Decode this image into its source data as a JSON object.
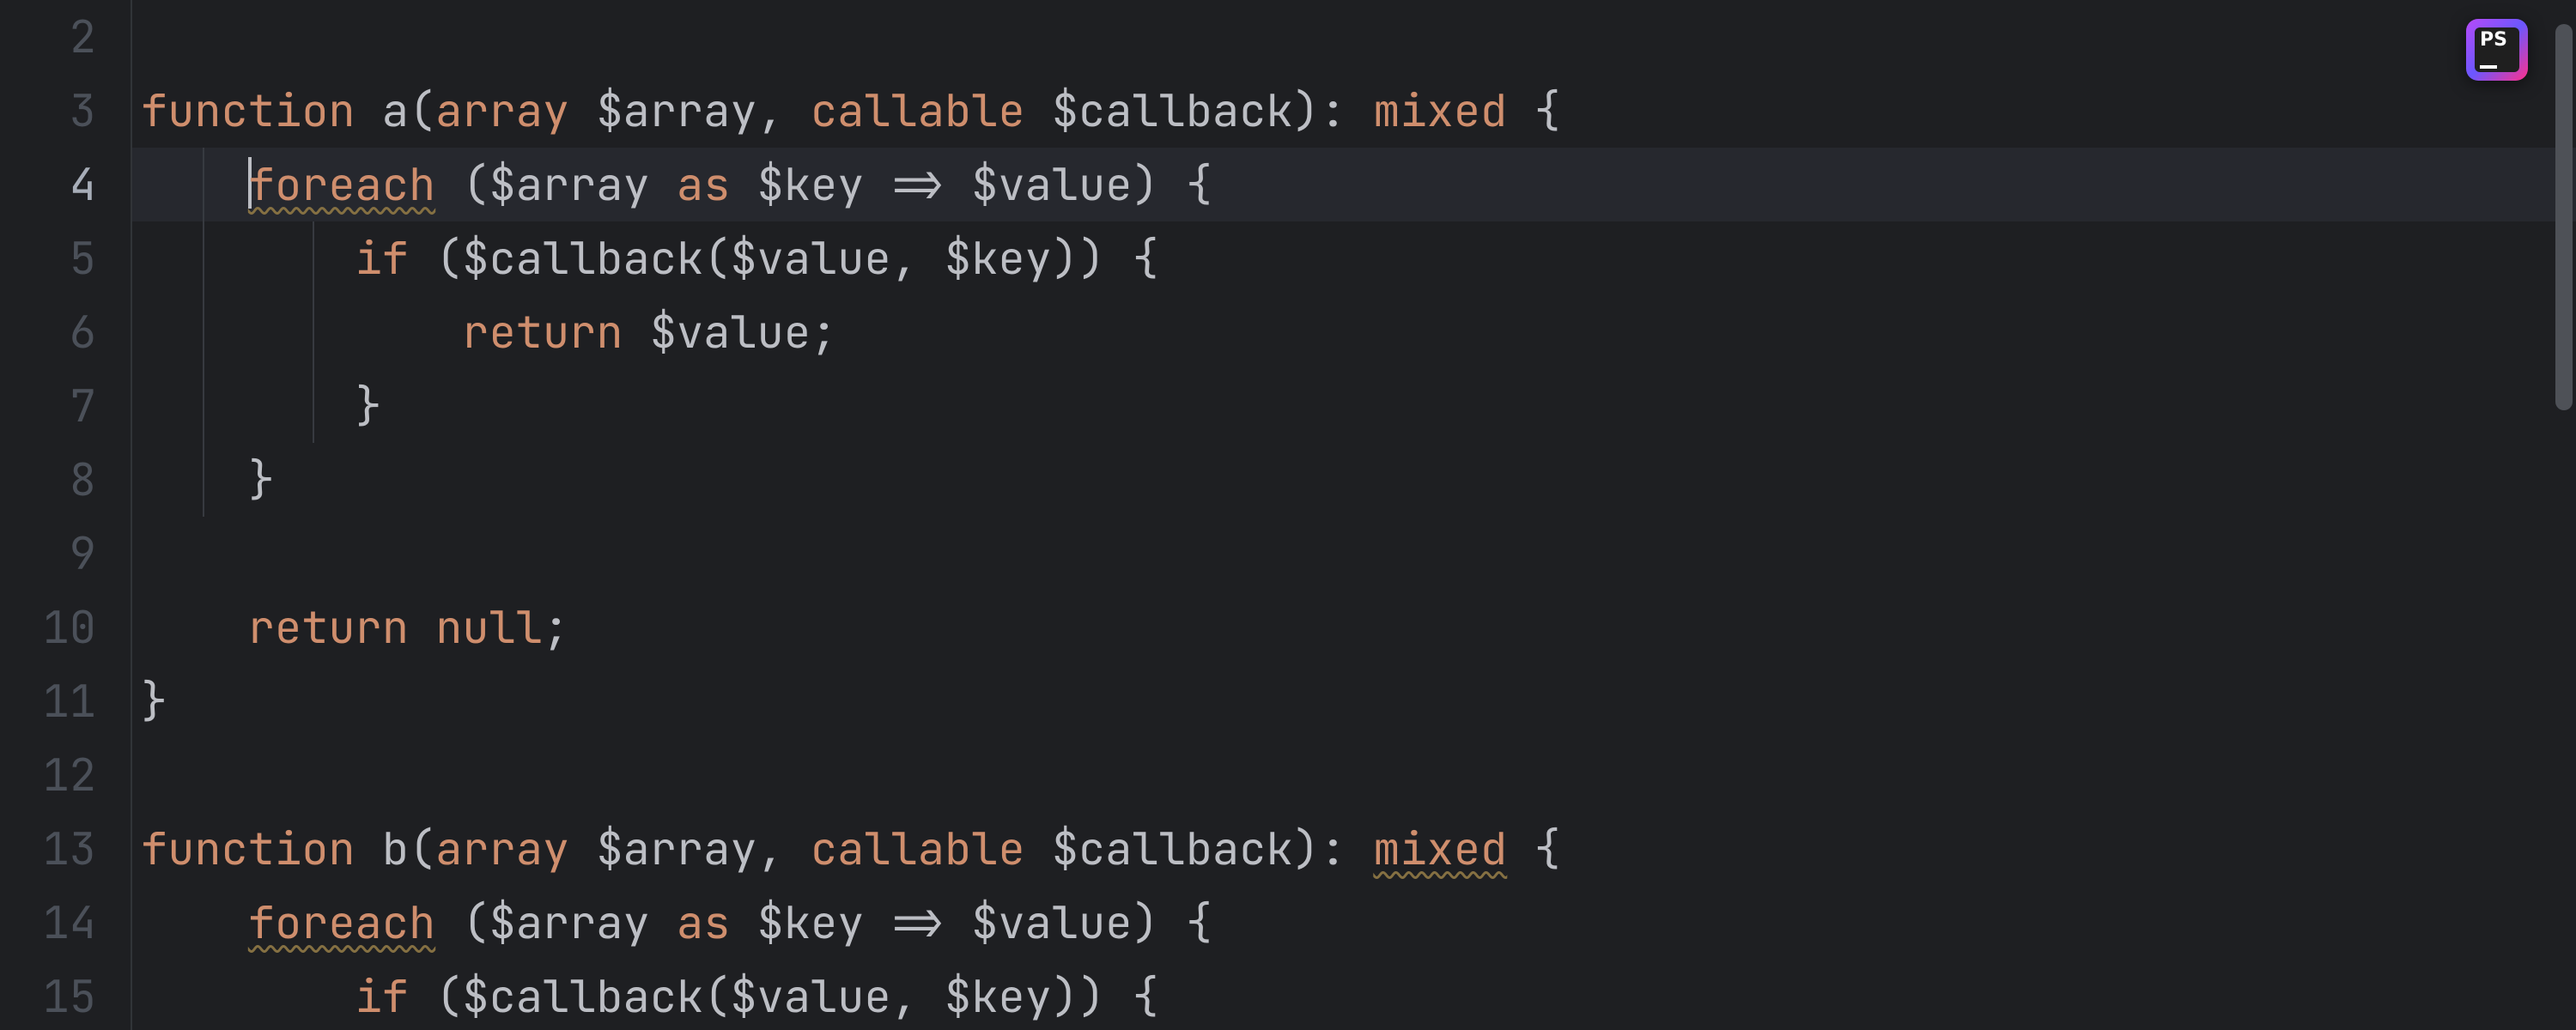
{
  "ide": {
    "badge_text": "PS"
  },
  "gutter": {
    "start": 2,
    "end": 15,
    "current": 4
  },
  "code": {
    "lines": [
      {
        "n": 2,
        "indent": 0,
        "guides": [],
        "tokens": []
      },
      {
        "n": 3,
        "indent": 0,
        "guides": [],
        "tokens": [
          [
            "kw",
            "function"
          ],
          [
            "sp",
            " "
          ],
          [
            "d",
            "a"
          ],
          [
            "d",
            "("
          ],
          [
            "kw",
            "array"
          ],
          [
            "sp",
            " "
          ],
          [
            "d",
            "$array"
          ],
          [
            "d",
            ","
          ],
          [
            "sp",
            " "
          ],
          [
            "kw",
            "callable"
          ],
          [
            "sp",
            " "
          ],
          [
            "d",
            "$callback"
          ],
          [
            "d",
            ")"
          ],
          [
            "d",
            ":"
          ],
          [
            "sp",
            " "
          ],
          [
            "kw",
            "mixed"
          ],
          [
            "sp",
            " "
          ],
          [
            "d",
            "{"
          ]
        ]
      },
      {
        "n": 4,
        "indent": 1,
        "guides": [
          1
        ],
        "current": true,
        "caret": true,
        "tokens": [
          [
            "kw wavy",
            "foreach"
          ],
          [
            "sp",
            " "
          ],
          [
            "d",
            "("
          ],
          [
            "d",
            "$array"
          ],
          [
            "sp",
            " "
          ],
          [
            "kw",
            "as"
          ],
          [
            "sp",
            " "
          ],
          [
            "d",
            "$key"
          ],
          [
            "sp",
            " "
          ],
          [
            "d",
            "=>"
          ],
          [
            "sp",
            " "
          ],
          [
            "d",
            "$value"
          ],
          [
            "d",
            ")"
          ],
          [
            "sp",
            " "
          ],
          [
            "d",
            "{"
          ]
        ]
      },
      {
        "n": 5,
        "indent": 2,
        "guides": [
          1,
          2
        ],
        "tokens": [
          [
            "kw",
            "if"
          ],
          [
            "sp",
            " "
          ],
          [
            "d",
            "("
          ],
          [
            "d",
            "$callback"
          ],
          [
            "d",
            "("
          ],
          [
            "d",
            "$value"
          ],
          [
            "d",
            ","
          ],
          [
            "sp",
            " "
          ],
          [
            "d",
            "$key"
          ],
          [
            "d",
            "))"
          ],
          [
            "sp",
            " "
          ],
          [
            "d",
            "{"
          ]
        ]
      },
      {
        "n": 6,
        "indent": 3,
        "guides": [
          1,
          2
        ],
        "tokens": [
          [
            "kw",
            "return"
          ],
          [
            "sp",
            " "
          ],
          [
            "d",
            "$value"
          ],
          [
            "d",
            ";"
          ]
        ]
      },
      {
        "n": 7,
        "indent": 2,
        "guides": [
          1,
          2
        ],
        "tokens": [
          [
            "d",
            "}"
          ]
        ]
      },
      {
        "n": 8,
        "indent": 1,
        "guides": [
          1
        ],
        "tokens": [
          [
            "d",
            "}"
          ]
        ]
      },
      {
        "n": 9,
        "indent": 0,
        "guides": [],
        "tokens": []
      },
      {
        "n": 10,
        "indent": 1,
        "guides": [],
        "tokens": [
          [
            "kw",
            "return"
          ],
          [
            "sp",
            " "
          ],
          [
            "kw",
            "null"
          ],
          [
            "d",
            ";"
          ]
        ]
      },
      {
        "n": 11,
        "indent": 0,
        "guides": [],
        "tokens": [
          [
            "d",
            "}"
          ]
        ]
      },
      {
        "n": 12,
        "indent": 0,
        "guides": [],
        "tokens": []
      },
      {
        "n": 13,
        "indent": 0,
        "guides": [],
        "tokens": [
          [
            "kw",
            "function"
          ],
          [
            "sp",
            " "
          ],
          [
            "d",
            "b"
          ],
          [
            "d",
            "("
          ],
          [
            "kw",
            "array"
          ],
          [
            "sp",
            " "
          ],
          [
            "d",
            "$array"
          ],
          [
            "d",
            ","
          ],
          [
            "sp",
            " "
          ],
          [
            "kw",
            "callable"
          ],
          [
            "sp",
            " "
          ],
          [
            "d",
            "$callback"
          ],
          [
            "d",
            ")"
          ],
          [
            "d",
            ":"
          ],
          [
            "sp",
            " "
          ],
          [
            "kw wavy",
            "mixed"
          ],
          [
            "sp",
            " "
          ],
          [
            "d",
            "{"
          ]
        ]
      },
      {
        "n": 14,
        "indent": 1,
        "guides": [],
        "tokens": [
          [
            "kw wavy",
            "foreach"
          ],
          [
            "sp",
            " "
          ],
          [
            "d",
            "("
          ],
          [
            "d",
            "$array"
          ],
          [
            "sp",
            " "
          ],
          [
            "kw",
            "as"
          ],
          [
            "sp",
            " "
          ],
          [
            "d",
            "$key"
          ],
          [
            "sp",
            " "
          ],
          [
            "d",
            "=>"
          ],
          [
            "sp",
            " "
          ],
          [
            "d",
            "$value"
          ],
          [
            "d",
            ")"
          ],
          [
            "sp",
            " "
          ],
          [
            "d",
            "{"
          ]
        ]
      },
      {
        "n": 15,
        "indent": 2,
        "guides": [],
        "tokens": [
          [
            "kw",
            "if"
          ],
          [
            "sp",
            " "
          ],
          [
            "d",
            "("
          ],
          [
            "d",
            "$callback"
          ],
          [
            "d",
            "("
          ],
          [
            "d",
            "$value"
          ],
          [
            "d",
            ","
          ],
          [
            "sp",
            " "
          ],
          [
            "d",
            "$key"
          ],
          [
            "d",
            "))"
          ],
          [
            "sp",
            " "
          ],
          [
            "d",
            "{"
          ]
        ]
      }
    ]
  },
  "colors": {
    "background": "#1e1f22",
    "current_line": "#26282e",
    "gutter_fg": "#4b5059",
    "gutter_current_fg": "#a7adb8",
    "default_fg": "#bcbec4",
    "keyword_fg": "#cf8e6d",
    "wavy_underline": "#857042",
    "indent_guide": "#373a40",
    "scrollbar_thumb": "#4e5157"
  }
}
